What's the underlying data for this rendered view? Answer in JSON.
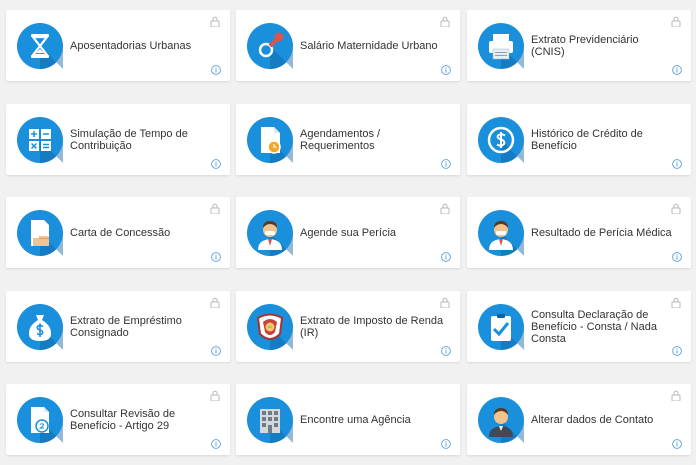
{
  "colors": {
    "accent": "#1a8fdb",
    "accent_dark": "#0f63a3",
    "page_bg": "#f1f1f1",
    "card_bg": "#ffffff",
    "text": "#333333",
    "lock": "#b8b8b8",
    "info": "#5aa0d8"
  },
  "services": [
    {
      "label": "Aposentadorias Urbanas",
      "icon": "hourglass-icon",
      "locked": true
    },
    {
      "label": "Salário Maternidade Urbano",
      "icon": "pacifier-icon",
      "locked": true
    },
    {
      "label": "Extrato Previdenciário (CNIS)",
      "icon": "printer-icon",
      "locked": true
    },
    {
      "label": "Simulação de Tempo de Contribuição",
      "icon": "calculator-icon",
      "locked": false
    },
    {
      "label": "Agendamentos / Requerimentos",
      "icon": "document-clock-icon",
      "locked": false
    },
    {
      "label": "Histórico de Crédito de Benefício",
      "icon": "dollar-coin-icon",
      "locked": false
    },
    {
      "label": "Carta de Concessão",
      "icon": "letter-hand-icon",
      "locked": true
    },
    {
      "label": "Agende sua Perícia",
      "icon": "doctor-icon",
      "locked": true
    },
    {
      "label": "Resultado de Perícia Médica",
      "icon": "doctor-icon",
      "locked": true
    },
    {
      "label": "Extrato de Empréstimo Consignado",
      "icon": "money-bag-icon",
      "locked": true
    },
    {
      "label": "Extrato de Imposto de Renda (IR)",
      "icon": "lion-icon",
      "locked": true
    },
    {
      "label": "Consulta Declaração de Benefício - Consta / Nada Consta",
      "icon": "clipboard-check-icon",
      "locked": true
    },
    {
      "label": "Consultar Revisão de Benefício - Artigo 29",
      "icon": "document-number-icon",
      "locked": true
    },
    {
      "label": "Encontre uma Agência",
      "icon": "building-icon",
      "locked": false
    },
    {
      "label": "Alterar dados de Contato",
      "icon": "person-icon",
      "locked": true
    }
  ]
}
